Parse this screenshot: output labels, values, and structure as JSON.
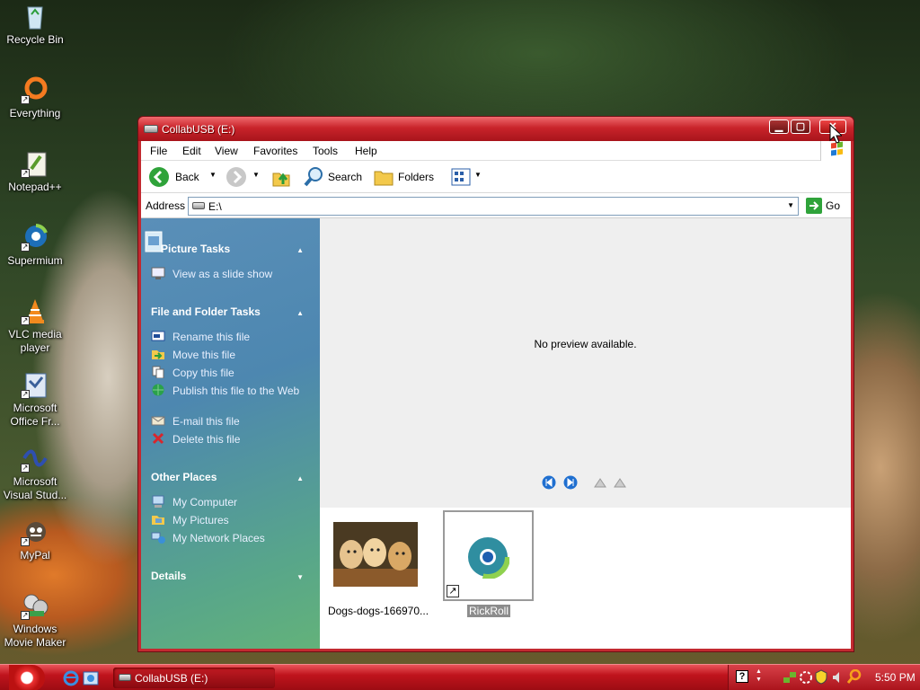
{
  "desktop": {
    "icons": [
      {
        "label": "Recycle Bin",
        "icon": "recycle-bin-icon"
      },
      {
        "label": "Everything",
        "icon": "everything-icon"
      },
      {
        "label": "Notepad++",
        "icon": "notepad-icon"
      },
      {
        "label": "Supermium",
        "icon": "supermium-icon"
      },
      {
        "label": "VLC media player",
        "icon": "vlc-icon"
      },
      {
        "label": "Microsoft Office Fr...",
        "icon": "office-icon"
      },
      {
        "label": "Microsoft Visual Stud...",
        "icon": "visual-studio-icon"
      },
      {
        "label": "MyPal",
        "icon": "mypal-icon"
      },
      {
        "label": "Windows Movie Maker",
        "icon": "movie-maker-icon"
      }
    ]
  },
  "window": {
    "title": "CollabUSB (E:)",
    "menu": [
      "File",
      "Edit",
      "View",
      "Favorites",
      "Tools",
      "Help"
    ],
    "toolbar": {
      "back": "Back",
      "search": "Search",
      "folders": "Folders"
    },
    "address": {
      "label": "Address",
      "value": "E:\\",
      "go": "Go"
    },
    "tasks": {
      "picture_tasks": {
        "title": "Picture Tasks",
        "items": [
          "View as a slide show"
        ]
      },
      "file_folder_tasks": {
        "title": "File and Folder Tasks",
        "items": [
          "Rename this file",
          "Move this file",
          "Copy this file",
          "Publish this file to the Web",
          "E-mail this file",
          "Delete this file"
        ]
      },
      "other_places": {
        "title": "Other Places",
        "items": [
          "My Computer",
          "My Pictures",
          "My Network Places"
        ]
      },
      "details": {
        "title": "Details"
      }
    },
    "preview_text": "No preview available.",
    "files": [
      {
        "name": "Dogs-dogs-166970..."
      },
      {
        "name": "RickRoll"
      }
    ]
  },
  "taskbar": {
    "task": "CollabUSB (E:)",
    "time": "5:50 PM"
  },
  "colors": {
    "theme_red": "#c22a30",
    "task_pane_blue": "#4d87b0",
    "task_pane_green": "#63b27a"
  }
}
